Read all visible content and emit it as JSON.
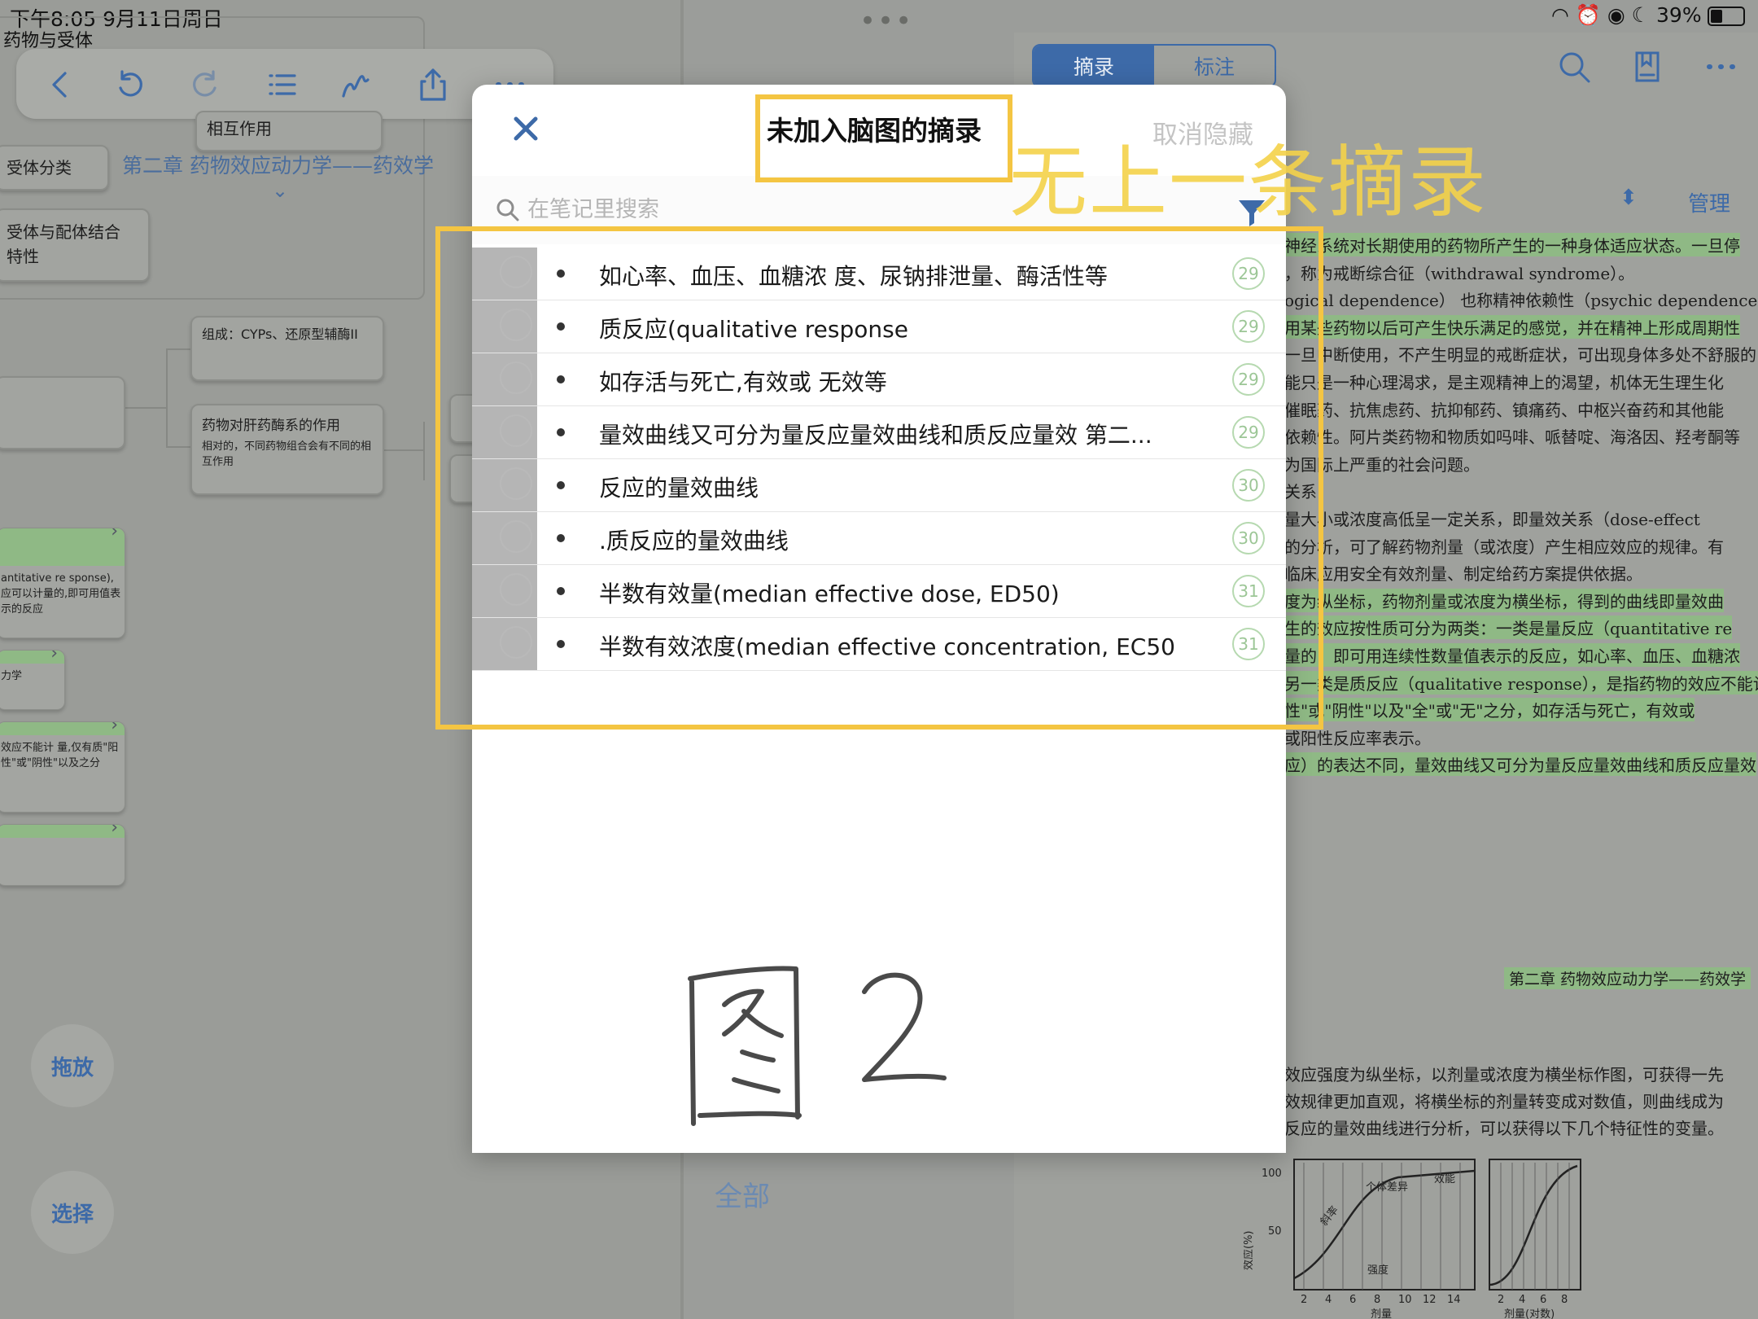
{
  "status_bar": {
    "time_date": "下午8:05   9月11日周日",
    "battery": "39%"
  },
  "left_pane": {
    "doc_name": "药物与受体",
    "toolbar": {
      "icons": [
        "chevron-left-icon",
        "undo-icon",
        "redo-icon",
        "list-icon",
        "pen-icon",
        "share-icon",
        "more-icon"
      ]
    },
    "nodes": {
      "interaction": "相互作用",
      "receptor_class": "受体分类",
      "receptor_binding_line1": "受体与配体结合",
      "receptor_binding_line2": "特性",
      "composition": "组成：CYPs、还原型辅酶II",
      "liver_enzyme_title": "药物对肝药酶系的作用",
      "liver_enzyme_note": "相对的，不同药物组合会有不同的相互作用",
      "green1_text": "antitative re sponse),应可以计量的,即可用值表示的反应",
      "green2_text": "力学",
      "green3_text": "效应不能计 量,仅有质\"阳性\"或\"阴性\"以及之分"
    },
    "chapter_title": "第二章 药物效应动力学——药效学",
    "buttons": {
      "drag": "拖放",
      "select": "选择"
    }
  },
  "bottom_bar": {
    "all_label": "全部"
  },
  "right_pane": {
    "tabs": {
      "excerpt": "摘录",
      "annotation": "标注"
    },
    "manage_label": "管理",
    "lines": [
      "神经系统对长期使用的药物所产生的一种身体适应状态。一旦停",
      "，称为戒断综合征（withdrawal syndrome）。",
      "ogical dependence）   也称精神依赖性（psychic dependence），",
      "用某些药物以后可产生快乐满足的感觉，并在精神上形成周期性",
      "一旦中断使用，不产生明显的戒断症状，可出现身体多处不舒服的",
      "能只是一种心理渴求，是主观精神上的渴望，机体无生理生化",
      "催眠药、抗焦虑药、抗抑郁药、镇痛药、中枢兴奋药和其他能",
      "依赖性。阿片类药物和物质如吗啡、哌替啶、海洛因、羟考酮等",
      "为国际上严重的社会问题。",
      "关系",
      "量大小或浓度高低呈一定关系，即量效关系（dose-effect",
      "的分析，可了解药物剂量（或浓度）产生相应效应的规律。有",
      "临床应用安全有效剂量、制定给药方案提供依据。",
      "度为纵坐标，药物剂量或浓度为横坐标，得到的曲线即量效曲",
      "生的效应按性质可分为两类：一类是量反应（quantitative re",
      "量的，即可用连续性数量值表示的反应，如心率、血压、血糖浓",
      "另一类是质反应（qualitative response），是指药物的效应不能计",
      "性\"或\"阴性\"以及\"全\"或\"无\"之分，如存活与死亡，有效或",
      "或阳性反应率表示。",
      "应）的表达不同，量效曲线又可分为量反应量效曲线和质反应量效"
    ],
    "chapter_footer": "第二章   药物效应动力学——药效学",
    "lines2": [
      "效应强度为纵坐标，以剂量或浓度为横坐标作图，可获得一先",
      "效规律更加直观，将横坐标的剂量转变成对数值，则曲线成为",
      "反应的量效曲线进行分析，可以获得以下几个特征性的变量。"
    ],
    "graph": {
      "y_label": "效应(%)",
      "y_ticks": [
        "100",
        "50"
      ],
      "x_label_left": "剂量",
      "x_label_right": "剂量(对数)",
      "x_ticks_left": [
        "2",
        "4",
        "6",
        "8",
        "10",
        "12",
        "14"
      ],
      "x_ticks_right": [
        "2",
        "4",
        "6",
        "8"
      ],
      "labels": {
        "efficacy": "效能",
        "variation": "个体差异",
        "slope": "斜率",
        "potency": "强度"
      }
    }
  },
  "popup": {
    "title": "未加入脑图的摘录",
    "unhide_label": "取消隐藏",
    "search_placeholder": "在笔记里搜索",
    "items": [
      {
        "text": "如心率、血压、血糖浓 度、尿钠排泄量、酶活性等",
        "page": "29"
      },
      {
        "text": "质反应(qualitative response",
        "page": "29"
      },
      {
        "text": "如存活与死亡,有效或 无效等",
        "page": "29"
      },
      {
        "text": "量效曲线又可分为量反应量效曲线和质反应量效 第二...",
        "page": "29"
      },
      {
        "text": "反应的量效曲线",
        "page": "30"
      },
      {
        "text": ".质反应的量效曲线",
        "page": "30"
      },
      {
        "text": "半数有效量(median effective dose, ED50)",
        "page": "31"
      },
      {
        "text": "半数有效浓度(median effective concentration, EC50",
        "page": "31"
      }
    ]
  },
  "annotation": {
    "note": "无上一条摘录",
    "handwriting": "图 2",
    "color": "#f4c542"
  },
  "colors": {
    "accent": "#3d6aa8",
    "highlight_green": "#8fb985",
    "page_badge": "#9cc696"
  }
}
